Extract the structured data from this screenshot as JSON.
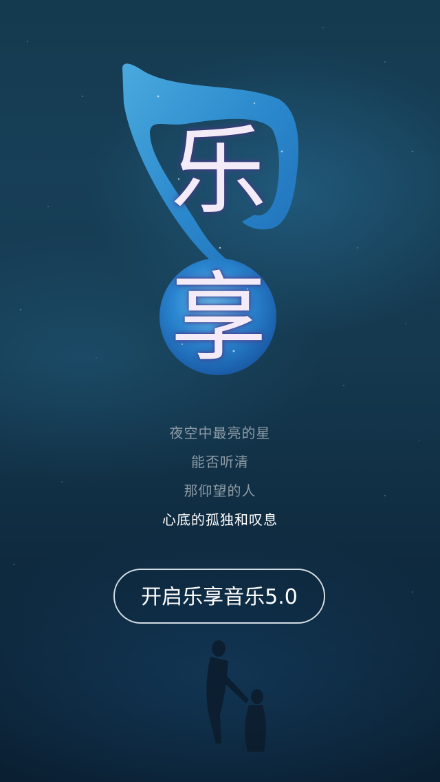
{
  "logo": {
    "char_1": "乐",
    "char_2": "享"
  },
  "poem": {
    "lines": [
      "夜空中最亮的星",
      "能否听清",
      "那仰望的人",
      "心底的孤独和叹息"
    ]
  },
  "start_button": {
    "label": "开启乐享音乐5.0"
  },
  "colors": {
    "background": "#15394f",
    "logo_blue": "#3a8fd8",
    "poem_text": "#8e9ca6",
    "highlight_text": "#ffffff",
    "button_border": "#d5dde3"
  }
}
